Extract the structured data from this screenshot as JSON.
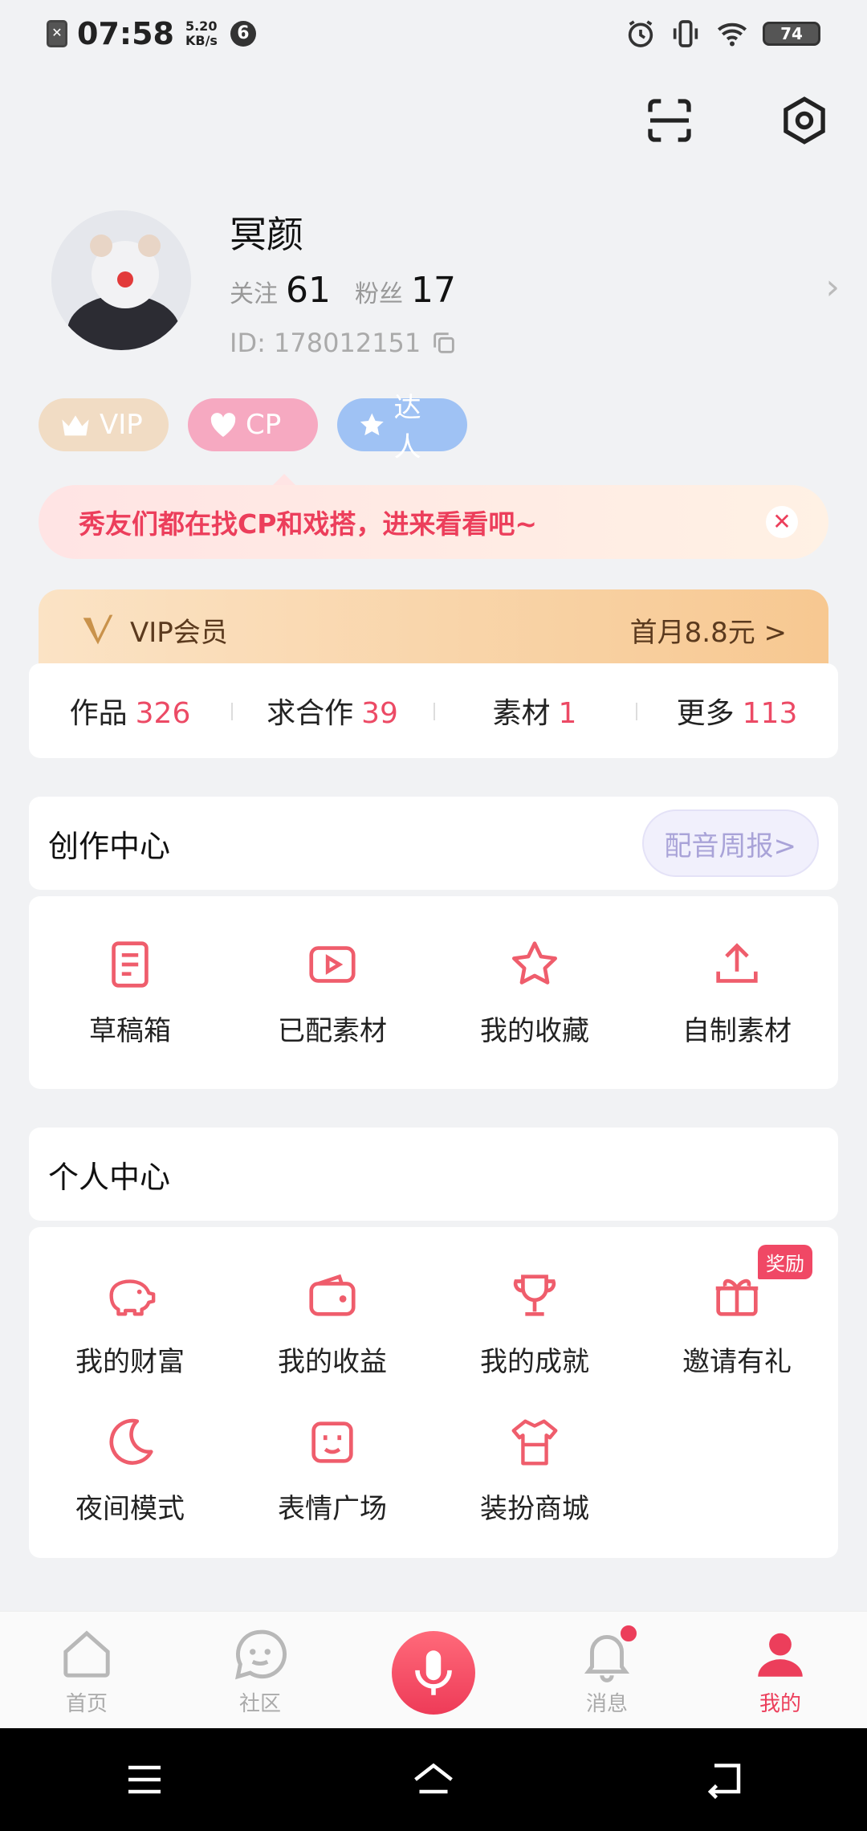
{
  "status_bar": {
    "time": "07:58",
    "speed_value": "5.20",
    "speed_unit": "KB/s",
    "notif_count": "6",
    "battery": "74"
  },
  "profile": {
    "name": "冥颜",
    "follow_label": "关注",
    "follow_count": "61",
    "fans_label": "粉丝",
    "fans_count": "17",
    "id_text": "ID: 178012151"
  },
  "badges": [
    {
      "label": "VIP",
      "icon": "crown-icon",
      "color": "#f1dcc4"
    },
    {
      "label": "CP",
      "icon": "heart-icon",
      "color": "#f6a9c1"
    },
    {
      "label": "达人",
      "icon": "star-icon",
      "color": "#9fc2f4"
    }
  ],
  "tip": {
    "text": "秀友们都在找CP和戏搭，进来看看吧~"
  },
  "vip_bar": {
    "title": "VIP会员",
    "offer": "首月8.8元 >"
  },
  "stats": [
    {
      "label": "作品",
      "count": "326"
    },
    {
      "label": "求合作",
      "count": "39"
    },
    {
      "label": "素材",
      "count": "1"
    },
    {
      "label": "更多",
      "count": "113"
    }
  ],
  "creation_center": {
    "title": "创作中心",
    "weekly_label": "配音周报>",
    "items": [
      {
        "label": "草稿箱",
        "icon": "draft-icon"
      },
      {
        "label": "已配素材",
        "icon": "play-icon"
      },
      {
        "label": "我的收藏",
        "icon": "star-icon"
      },
      {
        "label": "自制素材",
        "icon": "upload-icon"
      }
    ]
  },
  "personal_center": {
    "title": "个人中心",
    "items": [
      {
        "label": "我的财富",
        "icon": "piggy-bank-icon"
      },
      {
        "label": "我的收益",
        "icon": "wallet-icon"
      },
      {
        "label": "我的成就",
        "icon": "trophy-icon"
      },
      {
        "label": "邀请有礼",
        "icon": "gift-icon",
        "badge": "奖励"
      },
      {
        "label": "夜间模式",
        "icon": "moon-icon"
      },
      {
        "label": "表情广场",
        "icon": "emoji-icon"
      },
      {
        "label": "装扮商城",
        "icon": "shirt-icon"
      }
    ]
  },
  "tabs": [
    {
      "label": "首页",
      "icon": "home-icon"
    },
    {
      "label": "社区",
      "icon": "chat-icon"
    },
    {
      "label": "",
      "icon": "mic-icon"
    },
    {
      "label": "消息",
      "icon": "bell-icon"
    },
    {
      "label": "我的",
      "icon": "person-icon",
      "active": true
    }
  ],
  "accent_color": "#ec3e5b"
}
